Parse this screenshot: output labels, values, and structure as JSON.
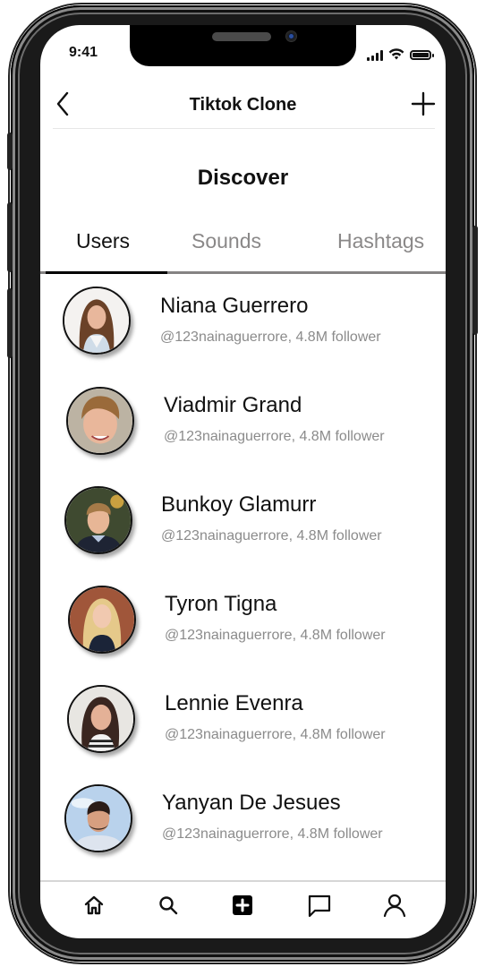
{
  "status_bar": {
    "time": "9:41",
    "icons": [
      "signal-icon",
      "wifi-icon",
      "battery-icon"
    ]
  },
  "navbar": {
    "title": "Tiktok Clone",
    "back_icon": "chevron-left-icon",
    "action_icon": "plus-icon"
  },
  "page": {
    "title": "Discover"
  },
  "tabs": [
    {
      "label": "Users",
      "active": true
    },
    {
      "label": "Sounds",
      "active": false
    },
    {
      "label": "Hashtags",
      "active": false
    }
  ],
  "users": [
    {
      "name": "Niana Guerrero",
      "handle_line": "@123nainaguerrore, 4.8M follower",
      "avatar": "avatar-photo-woman-long-brown-hair"
    },
    {
      "name": "Viadmir Grand",
      "handle_line": "@123nainaguerrore, 4.8M follower",
      "avatar": "avatar-photo-young-man-blond"
    },
    {
      "name": "Bunkoy Glamurr",
      "handle_line": "@123nainaguerrore, 4.8M follower",
      "avatar": "avatar-photo-man-sweater"
    },
    {
      "name": "Tyron Tigna",
      "handle_line": "@123nainaguerrore, 4.8M follower",
      "avatar": "avatar-photo-woman-blonde"
    },
    {
      "name": "Lennie Evenra",
      "handle_line": "@123nainaguerrore, 4.8M follower",
      "avatar": "avatar-photo-woman-dark-hair"
    },
    {
      "name": "Yanyan De Jesues",
      "handle_line": "@123nainaguerrore, 4.8M follower",
      "avatar": "avatar-photo-man-beard"
    }
  ],
  "bottom_nav": [
    {
      "name": "home",
      "icon": "home-icon"
    },
    {
      "name": "search",
      "icon": "search-icon"
    },
    {
      "name": "create",
      "icon": "plus-square-icon"
    },
    {
      "name": "messages",
      "icon": "chat-icon"
    },
    {
      "name": "profile",
      "icon": "user-icon"
    }
  ],
  "colors": {
    "text_primary": "#111111",
    "text_secondary": "#8b8b8b",
    "tab_inactive": "#8a8888",
    "tab_track": "#858383",
    "tab_indicator": "#000000"
  }
}
